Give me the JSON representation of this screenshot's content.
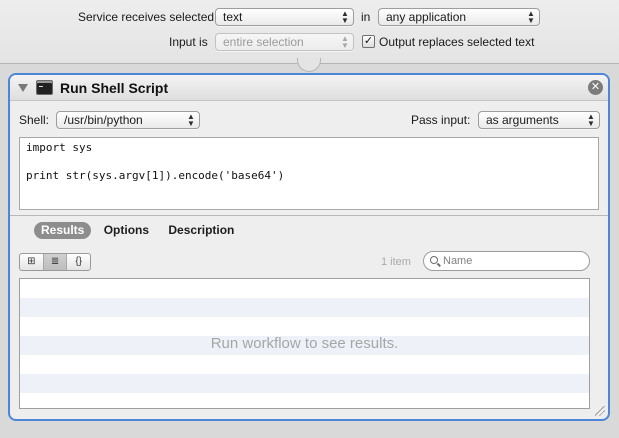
{
  "top": {
    "service_label": "Service receives selected",
    "service_value": "text",
    "in_label": "in",
    "app_value": "any application",
    "input_label": "Input is",
    "input_value": "entire selection",
    "output_checkbox_checked": true,
    "output_label": "Output replaces selected text"
  },
  "action": {
    "title": "Run Shell Script",
    "shell_label": "Shell:",
    "shell_value": "/usr/bin/python",
    "pass_input_label": "Pass input:",
    "pass_input_value": "as arguments",
    "script_lines": [
      "import sys",
      "",
      "print str(sys.argv[1]).encode('base64')",
      "",
      ""
    ]
  },
  "footer": {
    "tabs": [
      {
        "label": "Results",
        "active": true
      },
      {
        "label": "Options",
        "active": false
      },
      {
        "label": "Description",
        "active": false
      }
    ],
    "view_buttons": [
      "grid-view-icon",
      "list-view-icon",
      "code-view-icon"
    ],
    "item_count": "1 item",
    "search_placeholder": "Name",
    "results_message": "Run workflow to see results."
  },
  "colors": {
    "accent_border": "#4d86d6",
    "stripe": "#eef2f8"
  }
}
